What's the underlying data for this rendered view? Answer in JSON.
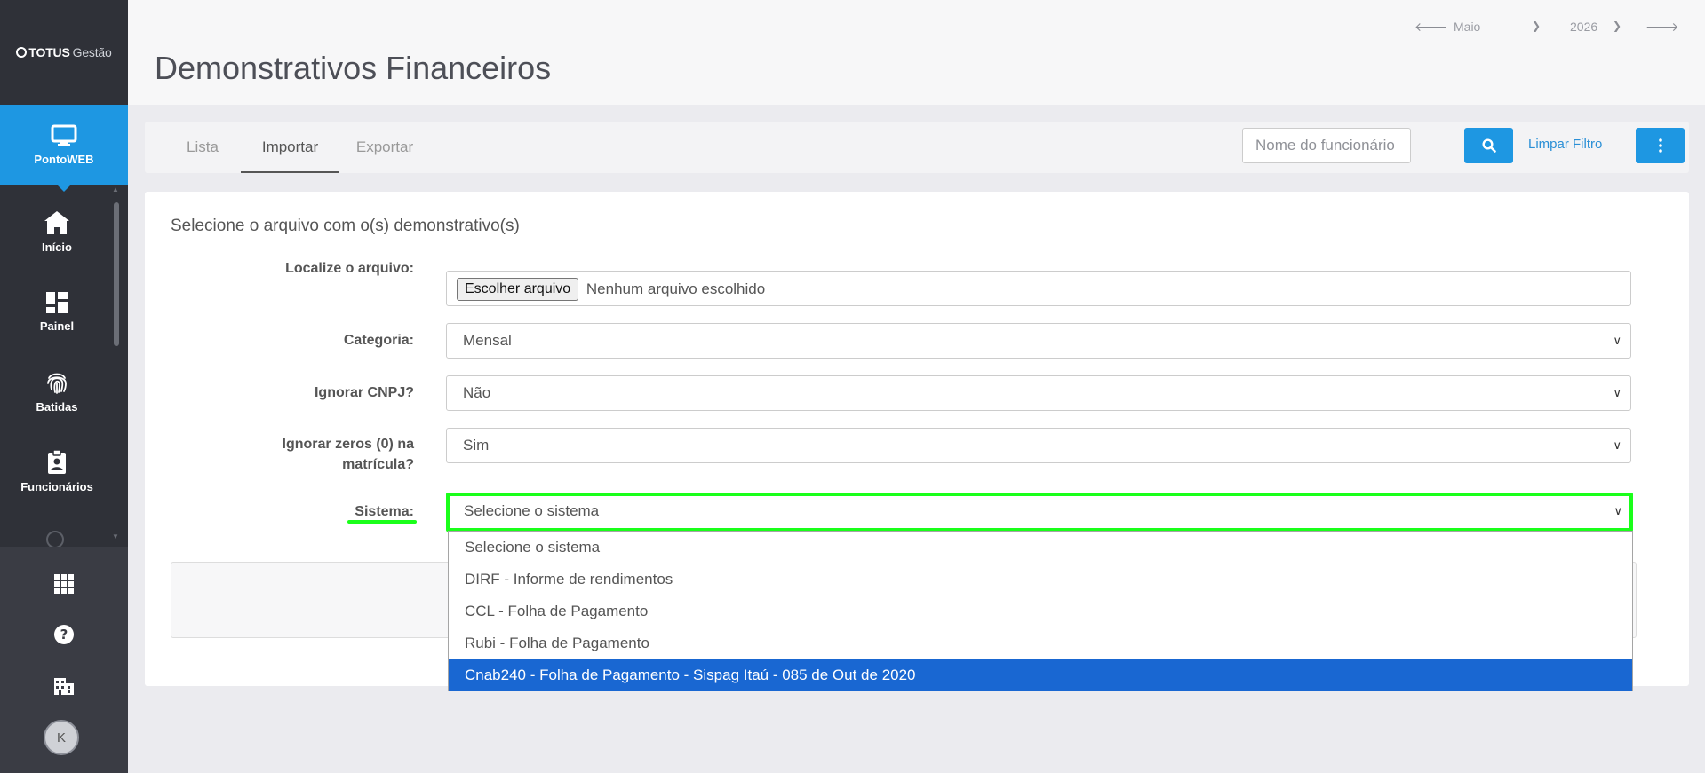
{
  "app": {
    "logo_brand": "TOTUS",
    "logo_product": "Gestão"
  },
  "sidebar": {
    "active": {
      "label": "PontoWEB",
      "icon": "monitor-icon"
    },
    "items": [
      {
        "label": "Início",
        "icon": "home-icon"
      },
      {
        "label": "Painel",
        "icon": "dashboard-icon"
      },
      {
        "label": "Batidas",
        "icon": "fingerprint-icon"
      },
      {
        "label": "Funcionários",
        "icon": "badge-icon"
      }
    ],
    "bottom_icons": [
      "apps-grid-icon",
      "help-icon",
      "building-icon"
    ],
    "avatar_initial": "K"
  },
  "header": {
    "title": "Demonstrativos Financeiros",
    "month": "Maio",
    "year": "2026"
  },
  "tabs": [
    {
      "label": "Lista"
    },
    {
      "label": "Importar"
    },
    {
      "label": "Exportar"
    }
  ],
  "filter": {
    "placeholder": "Nome do funcionário",
    "clear_label": "Limpar Filtro"
  },
  "form": {
    "title": "Selecione o arquivo com o(s) demonstrativo(s)",
    "file_label": "Localize o arquivo:",
    "file_button": "Escolher arquivo",
    "file_status": "Nenhum arquivo escolhido",
    "categoria_label": "Categoria:",
    "categoria_value": "Mensal",
    "cnpj_label": "Ignorar CNPJ?",
    "cnpj_value": "Não",
    "zeros_label": "Ignorar zeros (0) na matrícula?",
    "zeros_value": "Sim",
    "sistema_label": "Sistema:",
    "sistema_value": "Selecione o sistema",
    "sistema_options": [
      "Selecione o sistema",
      "DIRF - Informe de rendimentos",
      "CCL - Folha de Pagamento",
      "Rubi - Folha de Pagamento",
      "Cnab240 - Folha de Pagamento - Sispag Itaú - 085 de Out de 2020"
    ]
  },
  "colors": {
    "primary": "#1e97e2",
    "sidebar": "#2f3138",
    "highlight": "#1aff1a",
    "selected_option": "#1967d2"
  }
}
